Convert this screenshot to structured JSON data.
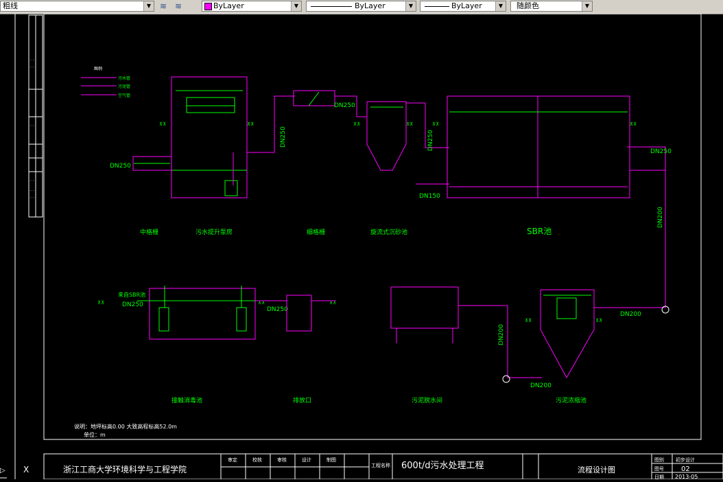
{
  "toolbar": {
    "linetype_combo": "粗线",
    "color_combo": "ByLayer",
    "linetype_combo2": "ByLayer",
    "lineweight_combo": "ByLayer",
    "plotstyle_combo": "随颜色",
    "layer_color": "#ff00ff"
  },
  "drawing": {
    "top_labels": {
      "zhongge": "中格栅",
      "pump_house": "污水提升泵房",
      "fine_screen": "细格栅",
      "grit": "旋流式沉砂池",
      "sbr": "SBR池"
    },
    "bottom_labels": {
      "disinfect": "接触消毒池",
      "outlet": "排放口",
      "dewater": "污泥脱水间",
      "thickener": "污泥浓缩池"
    },
    "pipe_labels": {
      "dn250_inlet": "DN250",
      "dn250_a": "DN250",
      "dn250_b": "DN250",
      "dn250_c": "DN250",
      "dn250_sbr_out": "DN250",
      "dn150": "DN150",
      "dn200_vertical": "DN200",
      "dn200_right": "DN200",
      "dn200_bottom": "DN200",
      "dn200_left_vertical": "DN200",
      "dn250_disinfect_in": "DN250",
      "dn250_disinfect_out": "DN250",
      "from_sbr": "来自SBR池"
    },
    "notes": {
      "note1": "说明：地坪标高0.00  大致高程标高52.0m",
      "note2": "单位：m"
    },
    "legend": {
      "title": "图例",
      "items": [
        "污水管",
        "污泥管",
        "空气管"
      ]
    }
  },
  "title_block": {
    "school": "浙江工商大学环境科学与工程学院",
    "project_label": "工程名称",
    "project_name": "600t/d污水处理工程",
    "drawing_name": "流程设计图",
    "sheet_no": "02",
    "design_stage": "初步设计",
    "date": "2013-05",
    "roles": [
      "审定",
      "校核",
      "审核",
      "设计",
      "制图"
    ],
    "fields": [
      "图别",
      "图号",
      "日期"
    ]
  }
}
